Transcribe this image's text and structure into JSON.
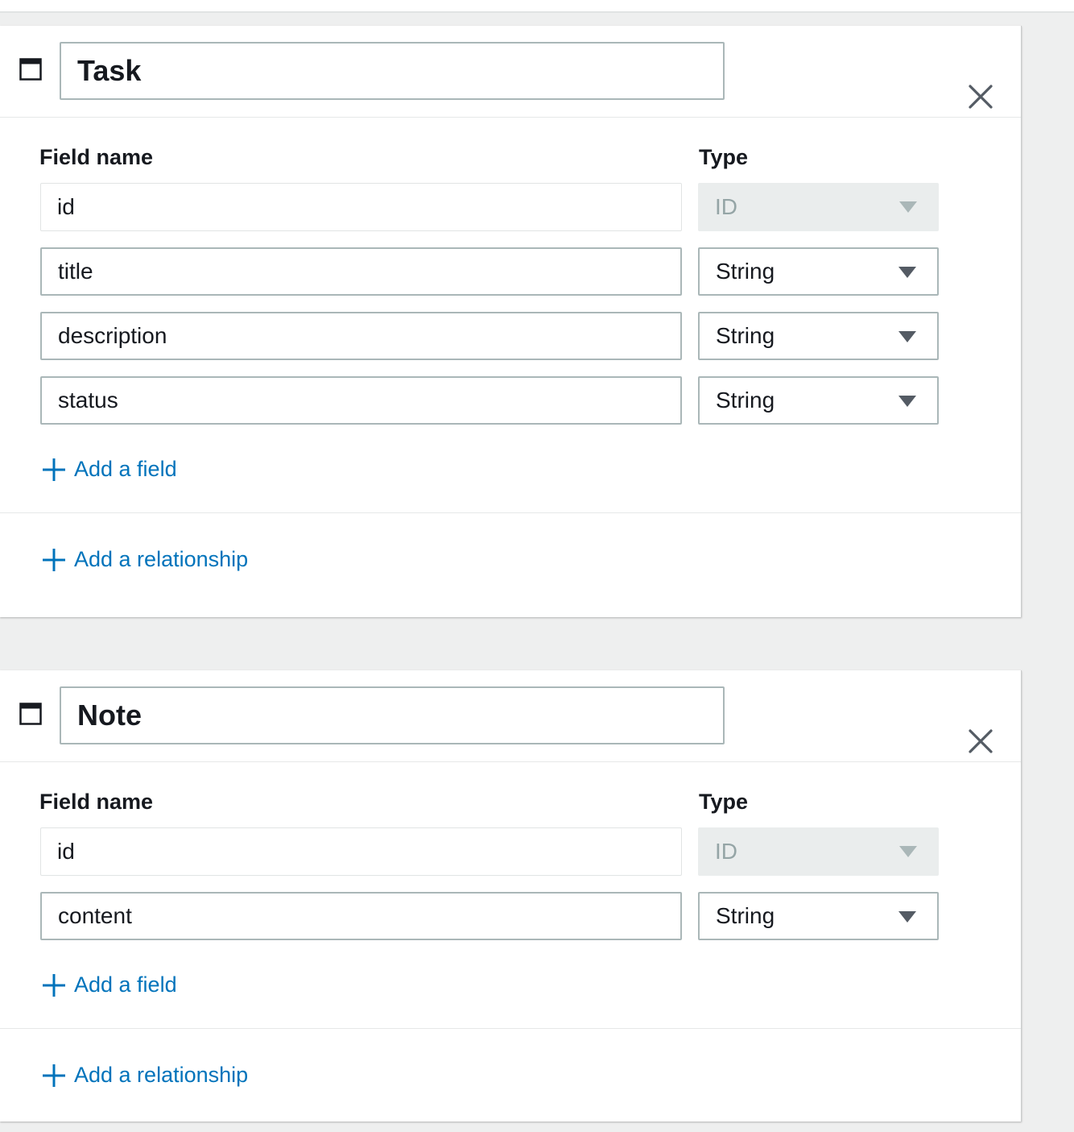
{
  "models": [
    {
      "name": "Task",
      "field_name_label": "Field name",
      "type_label": "Type",
      "fields": [
        {
          "name": "id",
          "type": "ID",
          "locked": true
        },
        {
          "name": "title",
          "type": "String",
          "locked": false
        },
        {
          "name": "description",
          "type": "String",
          "locked": false
        },
        {
          "name": "status",
          "type": "String",
          "locked": false
        }
      ],
      "add_field_label": "Add a field",
      "add_relationship_label": "Add a relationship"
    },
    {
      "name": "Note",
      "field_name_label": "Field name",
      "type_label": "Type",
      "fields": [
        {
          "name": "id",
          "type": "ID",
          "locked": true
        },
        {
          "name": "content",
          "type": "String",
          "locked": false
        }
      ],
      "add_field_label": "Add a field",
      "add_relationship_label": "Add a relationship"
    }
  ],
  "colors": {
    "link": "#0073bb",
    "border": "#aab7b8",
    "text": "#16191f",
    "disabled_bg": "#eaeded"
  }
}
